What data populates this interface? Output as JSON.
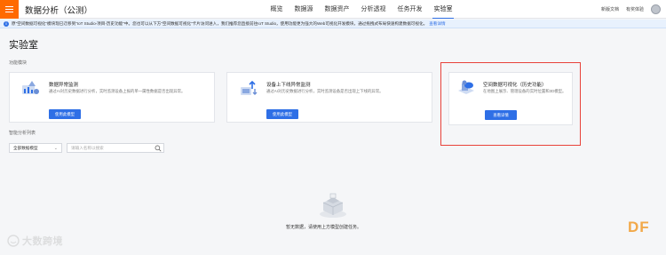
{
  "header": {
    "app_title": "数据分析（公测）",
    "nav": [
      "概览",
      "数据源",
      "数据资产",
      "分析透视",
      "任务开发",
      "实验室"
    ],
    "active_nav": "实验室",
    "right_links": [
      "新版文档",
      "有奖体验"
    ]
  },
  "notice": {
    "text": "原\"空间数据可视化\"模块现已迁移到\"IoT Studio-项目-历史功能\"中。您也可以从下方\"空间数据可视化\"卡片访问进入，我们推荐您直接前往IoT Studio，使用功能更为强大的Web可视化开发模块，通过拖拽式布局快速构建数据可视化。",
    "link": "查看详情"
  },
  "page_title": "实验室",
  "section_feature": "功能模块",
  "cards": [
    {
      "title": "数据异常监测",
      "desc": "通过AI对历史数据进行分析，实时监测设备上报的单一属性数据是否出现异常。",
      "button": "使用此模型",
      "icon": "analytics-icon"
    },
    {
      "title": "设备上下线异常监测",
      "desc": "通过AI对历史数据进行分析，实时监测设备是否出现上下线的异常。",
      "button": "使用此模型",
      "icon": "device-status-icon"
    },
    {
      "title": "空间数据可视化（历史功能）",
      "desc": "在地图上展示、管理设备的实时位置和3D模型。",
      "button": "查看详情",
      "icon": "spatial-visualization-icon"
    }
  ],
  "section_tasks": "智能分析列表",
  "filter": {
    "select_value": "全部数据模型",
    "search_placeholder": "请输入名称以搜索"
  },
  "empty_state": {
    "text": "暂无数据，请使用上方模型创建任务。"
  },
  "watermark_left": "大数跨境",
  "watermark_right": "DF",
  "colors": {
    "accent": "#2e6fe6",
    "brand": "#ff6a00",
    "highlight": "#e8423a"
  }
}
